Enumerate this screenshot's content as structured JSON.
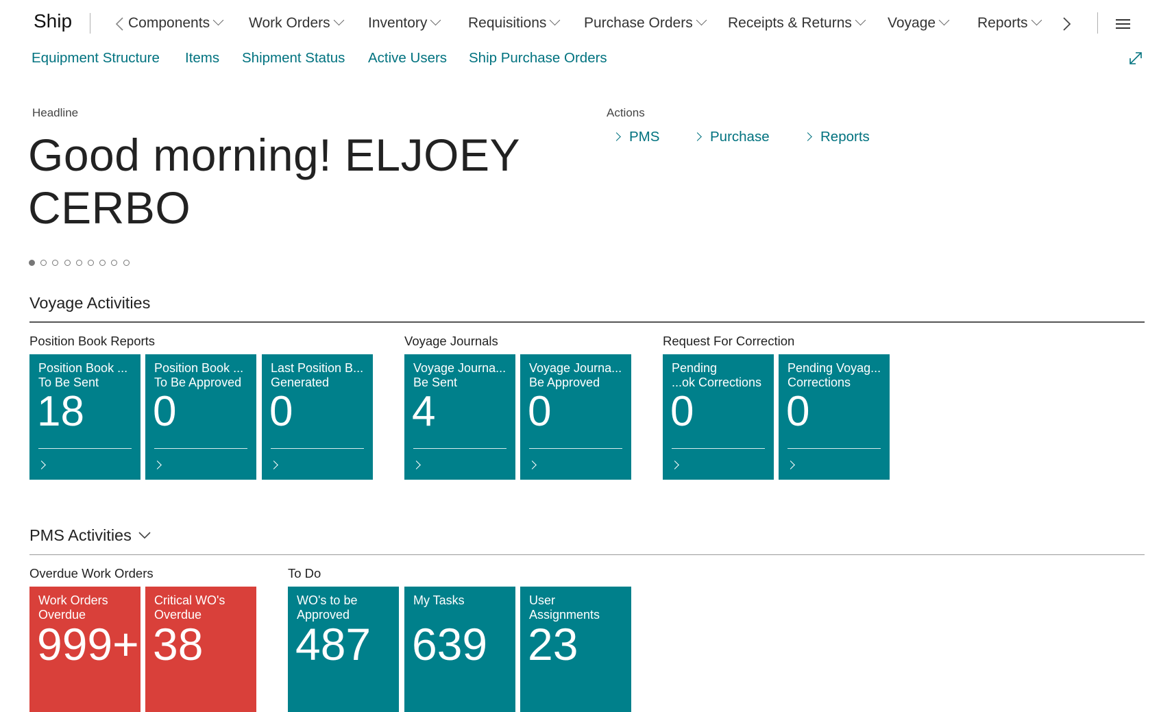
{
  "app_title": "Ship",
  "nav": {
    "items": [
      {
        "label": "Components"
      },
      {
        "label": "Work Orders"
      },
      {
        "label": "Inventory"
      },
      {
        "label": "Requisitions"
      },
      {
        "label": "Purchase Orders"
      },
      {
        "label": "Receipts & Returns"
      },
      {
        "label": "Voyage"
      },
      {
        "label": "Reports"
      }
    ]
  },
  "subnav": {
    "items": [
      {
        "label": "Equipment Structure"
      },
      {
        "label": "Items"
      },
      {
        "label": "Shipment Status"
      },
      {
        "label": "Active Users"
      },
      {
        "label": "Ship Purchase Orders"
      }
    ]
  },
  "headline": {
    "caption": "Headline",
    "text": "Good morning! ELJOEY CERBO",
    "dots_total": 9,
    "dots_active": 1
  },
  "actions": {
    "caption": "Actions",
    "links": [
      {
        "label": "PMS"
      },
      {
        "label": "Purchase"
      },
      {
        "label": "Reports"
      }
    ]
  },
  "voyage_activities": {
    "title": "Voyage Activities",
    "groups": [
      {
        "title": "Position Book Reports"
      },
      {
        "title": "Voyage Journals"
      },
      {
        "title": "Request For Correction"
      }
    ],
    "tiles": [
      {
        "label": "Position Book ...\nTo Be Sent",
        "value": "18"
      },
      {
        "label": "Position Book ...\nTo Be Approved",
        "value": "0"
      },
      {
        "label": "Last Position B...\nGenerated",
        "value": "0"
      },
      {
        "label": "Voyage Journa...\nBe Sent",
        "value": "4"
      },
      {
        "label": "Voyage Journa...\nBe Approved",
        "value": "0"
      },
      {
        "label": "Pending\n...ok Corrections",
        "value": "0"
      },
      {
        "label": "Pending Voyag...\nCorrections",
        "value": "0"
      }
    ]
  },
  "pms_activities": {
    "title": "PMS Activities",
    "groups": [
      {
        "title": "Overdue Work Orders"
      },
      {
        "title": "To Do"
      }
    ],
    "tiles": [
      {
        "label": "Work Orders\nOverdue",
        "value": "999+"
      },
      {
        "label": "Critical WO's\nOverdue",
        "value": "38"
      },
      {
        "label": "WO's to be\nApproved",
        "value": "487"
      },
      {
        "label": "My Tasks",
        "value": "639"
      },
      {
        "label": "User\nAssignments",
        "value": "23"
      }
    ]
  },
  "colors": {
    "accent": "#00727f",
    "tile_teal": "#00808b",
    "tile_red": "#d9403a"
  },
  "icons": [
    "chevron-left-icon",
    "chevron-right-icon",
    "hamburger-menu-icon",
    "expand-icon",
    "chevron-down-icon"
  ]
}
